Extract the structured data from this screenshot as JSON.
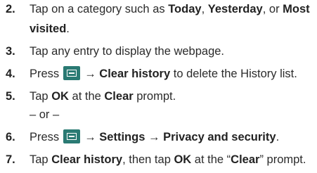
{
  "steps": [
    {
      "number": "2.",
      "line1": {
        "pre": "Tap on a category such as ",
        "b1": "Today",
        "m1": ", ",
        "b2": "Yesterday",
        "m2": ", or ",
        "b3": "Most"
      },
      "line2": {
        "b": "visited",
        "post": "."
      }
    },
    {
      "number": "3.",
      "text": "Tap any entry to display the webpage."
    },
    {
      "number": "4.",
      "pre": "Press",
      "arrow": "→",
      "b": "Clear history",
      "post": " to delete the History list."
    },
    {
      "number": "5.",
      "pre": "Tap ",
      "b1": "OK",
      "mid": " at the ",
      "b2": "Clear",
      "post": " prompt."
    },
    {
      "or_text": "– or –"
    },
    {
      "number": "6.",
      "pre": "Press",
      "arrow1": "→",
      "b1": "Settings",
      "arrow2": "→",
      "b2": "Privacy and security",
      "post": "."
    },
    {
      "number": "7.",
      "pre": "Tap ",
      "b1": "Clear history",
      "m1": ", then tap ",
      "b2": "OK",
      "m2": " at the “",
      "b3": "Clear",
      "post": "” prompt."
    }
  ],
  "icons": {
    "menu_key": "menu-key-icon"
  }
}
